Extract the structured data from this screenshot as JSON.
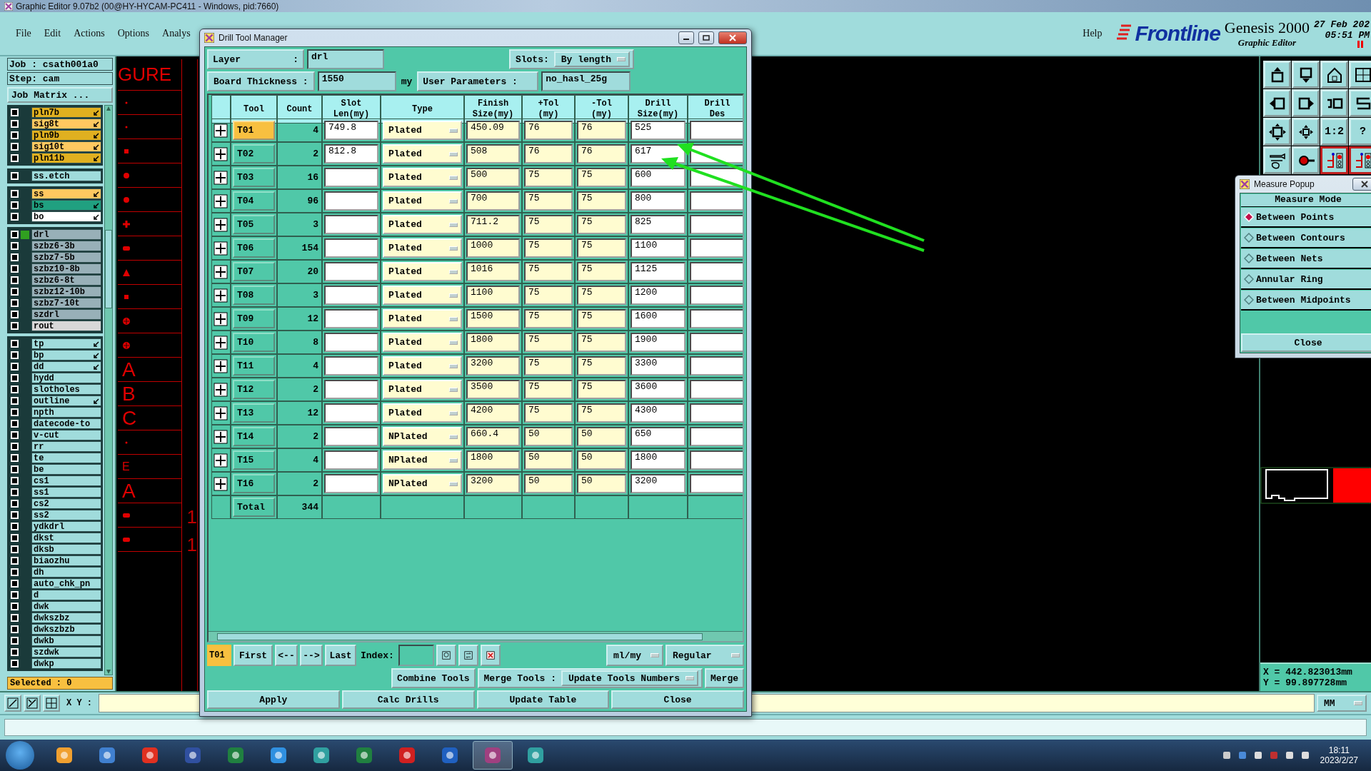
{
  "window": {
    "title": "Graphic Editor 9.07b2 (00@HY-HYCAM-PC411 - Windows, pid:7660)"
  },
  "menu": [
    "File",
    "Edit",
    "Actions",
    "Options",
    "Analys"
  ],
  "help": "Help",
  "brand": {
    "logo": "Frontline",
    "product": "Genesis 2000",
    "subtitle": "Graphic Editor",
    "date": "27 Feb 202",
    "time": "05:51 PM"
  },
  "job": {
    "job": "Job : csath001a0",
    "step": "Step: cam",
    "matrix_button": "Job Matrix ..."
  },
  "layer_groups": [
    {
      "layers": [
        {
          "name": "pln7b",
          "color": "#e0b020",
          "arrow": true,
          "checked": false,
          "selected": false
        },
        {
          "name": "sig8t",
          "color": "#ffc860",
          "arrow": true,
          "checked": false,
          "selected": false
        },
        {
          "name": "pln9b",
          "color": "#e0b020",
          "arrow": true,
          "checked": false,
          "selected": false
        },
        {
          "name": "sig10t",
          "color": "#ffc860",
          "arrow": true,
          "checked": false,
          "selected": false
        },
        {
          "name": "pln11b",
          "color": "#e0b020",
          "arrow": true,
          "checked": false,
          "selected": false
        }
      ]
    },
    {
      "layers": [
        {
          "name": "ss.etch",
          "color": "#a0dcdc",
          "arrow": false,
          "checked": false,
          "selected": false
        }
      ]
    },
    {
      "layers": [
        {
          "name": "ss",
          "color": "#ffc860",
          "arrow": true,
          "checked": false,
          "selected": false
        },
        {
          "name": "bs",
          "color": "#20a080",
          "arrow": true,
          "checked": false,
          "selected": false
        },
        {
          "name": "bo",
          "color": "#ffffff",
          "arrow": true,
          "checked": false,
          "selected": false
        }
      ]
    },
    {
      "layers": [
        {
          "name": "drl",
          "color": "#98b0b8",
          "arrow": false,
          "checked": false,
          "selected": true
        },
        {
          "name": "szbz6-3b",
          "color": "#98b0b8",
          "arrow": false,
          "checked": false,
          "selected": false
        },
        {
          "name": "szbz7-5b",
          "color": "#98b0b8",
          "arrow": false,
          "checked": false,
          "selected": false
        },
        {
          "name": "szbz10-8b",
          "color": "#98b0b8",
          "arrow": false,
          "checked": false,
          "selected": false
        },
        {
          "name": "szbz6-8t",
          "color": "#98b0b8",
          "arrow": false,
          "checked": false,
          "selected": false
        },
        {
          "name": "szbz12-10b",
          "color": "#98b0b8",
          "arrow": false,
          "checked": false,
          "selected": false
        },
        {
          "name": "szbz7-10t",
          "color": "#98b0b8",
          "arrow": false,
          "checked": false,
          "selected": false
        },
        {
          "name": "szdrl",
          "color": "#98b0b8",
          "arrow": false,
          "checked": false,
          "selected": false
        },
        {
          "name": "rout",
          "color": "#d8d8d8",
          "arrow": false,
          "checked": false,
          "selected": false
        }
      ]
    },
    {
      "layers": [
        {
          "name": "tp",
          "color": "#a0dcdc",
          "arrow": true,
          "checked": false,
          "selected": false
        },
        {
          "name": "bp",
          "color": "#a0dcdc",
          "arrow": true,
          "checked": false,
          "selected": false
        },
        {
          "name": "dd",
          "color": "#a0dcdc",
          "arrow": true,
          "checked": false,
          "selected": false
        },
        {
          "name": "hydd",
          "color": "#a0dcdc",
          "arrow": false,
          "checked": false,
          "selected": false
        },
        {
          "name": "slotholes",
          "color": "#a0dcdc",
          "arrow": false,
          "checked": false,
          "selected": false
        },
        {
          "name": "outline",
          "color": "#a0dcdc",
          "arrow": true,
          "checked": false,
          "selected": false
        },
        {
          "name": "npth",
          "color": "#a0dcdc",
          "arrow": false,
          "checked": false,
          "selected": false
        },
        {
          "name": "datecode-to",
          "color": "#a0dcdc",
          "arrow": false,
          "checked": false,
          "selected": false
        },
        {
          "name": "v-cut",
          "color": "#a0dcdc",
          "arrow": false,
          "checked": false,
          "selected": false
        },
        {
          "name": "rr",
          "color": "#a0dcdc",
          "arrow": false,
          "checked": false,
          "selected": false
        },
        {
          "name": "te",
          "color": "#a0dcdc",
          "arrow": false,
          "checked": false,
          "selected": false
        },
        {
          "name": "be",
          "color": "#a0dcdc",
          "arrow": false,
          "checked": false,
          "selected": false
        },
        {
          "name": "cs1",
          "color": "#a0dcdc",
          "arrow": false,
          "checked": false,
          "selected": false
        },
        {
          "name": "ss1",
          "color": "#a0dcdc",
          "arrow": false,
          "checked": false,
          "selected": false
        },
        {
          "name": "cs2",
          "color": "#a0dcdc",
          "arrow": false,
          "checked": false,
          "selected": false
        },
        {
          "name": "ss2",
          "color": "#a0dcdc",
          "arrow": false,
          "checked": false,
          "selected": false
        },
        {
          "name": "ydkdrl",
          "color": "#a0dcdc",
          "arrow": false,
          "checked": false,
          "selected": false
        },
        {
          "name": "dkst",
          "color": "#a0dcdc",
          "arrow": false,
          "checked": false,
          "selected": false
        },
        {
          "name": "dksb",
          "color": "#a0dcdc",
          "arrow": false,
          "checked": false,
          "selected": false
        },
        {
          "name": "biaozhu",
          "color": "#a0dcdc",
          "arrow": false,
          "checked": false,
          "selected": false
        },
        {
          "name": "dh",
          "color": "#a0dcdc",
          "arrow": false,
          "checked": false,
          "selected": false
        },
        {
          "name": "auto_chk_pn",
          "color": "#a0dcdc",
          "arrow": false,
          "checked": false,
          "selected": false
        },
        {
          "name": "d",
          "color": "#a0dcdc",
          "arrow": false,
          "checked": false,
          "selected": false
        },
        {
          "name": "dwk",
          "color": "#a0dcdc",
          "arrow": false,
          "checked": false,
          "selected": false
        },
        {
          "name": "dwkszbz",
          "color": "#a0dcdc",
          "arrow": false,
          "checked": false,
          "selected": false
        },
        {
          "name": "dwkszbzb",
          "color": "#a0dcdc",
          "arrow": false,
          "checked": false,
          "selected": false
        },
        {
          "name": "dwkb",
          "color": "#a0dcdc",
          "arrow": false,
          "checked": false,
          "selected": false
        },
        {
          "name": "szdwk",
          "color": "#a0dcdc",
          "arrow": false,
          "checked": false,
          "selected": false
        },
        {
          "name": "dwkp",
          "color": "#a0dcdc",
          "arrow": false,
          "checked": false,
          "selected": false
        }
      ]
    }
  ],
  "selected_count": "Selected : 0",
  "canvas": {
    "header": "GURE",
    "legend": [
      {
        "kind": "dot"
      },
      {
        "kind": "dot"
      },
      {
        "kind": "square"
      },
      {
        "kind": "circle"
      },
      {
        "kind": "circle"
      },
      {
        "kind": "plus"
      },
      {
        "kind": "bar"
      },
      {
        "kind": "triangle"
      },
      {
        "kind": "square"
      },
      {
        "kind": "target"
      },
      {
        "kind": "target"
      },
      {
        "kind": "letter",
        "text": "A"
      },
      {
        "kind": "letter",
        "text": "B"
      },
      {
        "kind": "letter",
        "text": "C"
      },
      {
        "kind": "dot"
      },
      {
        "kind": "small_letter",
        "text": "E"
      },
      {
        "kind": "letter",
        "text": "A"
      },
      {
        "kind": "bar"
      },
      {
        "kind": "bar"
      }
    ],
    "side_labels": [
      "1",
      "1"
    ]
  },
  "toolbar": [
    {
      "kind": "box_up",
      "active": false
    },
    {
      "kind": "box_down",
      "active": false
    },
    {
      "kind": "house",
      "active": false
    },
    {
      "kind": "grid",
      "active": false
    },
    {
      "kind": "box_left",
      "active": false
    },
    {
      "kind": "box_right",
      "active": false
    },
    {
      "kind": "undo",
      "active": false
    },
    {
      "kind": "s_path",
      "active": false
    },
    {
      "kind": "fit",
      "active": false
    },
    {
      "kind": "pan",
      "active": false
    },
    {
      "kind": "text",
      "text": "1:2",
      "active": false
    },
    {
      "kind": "text",
      "text": "?",
      "active": false
    },
    {
      "kind": "wrench",
      "active": false
    },
    {
      "kind": "pin",
      "active": false
    },
    {
      "kind": "circuit",
      "active": true
    },
    {
      "kind": "circuit",
      "active": true
    }
  ],
  "coords": {
    "x": "X = 442.823013mm",
    "y": "Y = 99.897728mm"
  },
  "xy_bar": {
    "label": "X Y :",
    "units": "MM"
  },
  "taskbar": {
    "time": "18:11",
    "date": "2023/2/27"
  },
  "drill_manager": {
    "title": "Drill Tool Manager",
    "layer_label": "Layer",
    "layer_sep": ":",
    "layer": "drl",
    "slots_label": "Slots:",
    "slots": "By length",
    "thickness_label": "Board Thickness :",
    "thickness": "1550",
    "thickness_unit": "my",
    "user_params_label": "User Parameters :",
    "user_params": "no_hasl_25g",
    "columns": [
      "Tool",
      "Count",
      "Slot\nLen(my)",
      "Type",
      "Finish\nSize(my)",
      "+Tol\n(my)",
      "-Tol\n(my)",
      "Drill\nSize(my)",
      "Drill\nDes"
    ],
    "rows": [
      {
        "tool": "T01",
        "count": "4",
        "slot_len": "749.8",
        "type": "Plated",
        "finish": "450.09",
        "plus_tol": "76",
        "minus_tol": "76",
        "drill_size": "525",
        "selected": true
      },
      {
        "tool": "T02",
        "count": "2",
        "slot_len": "812.8",
        "type": "Plated",
        "finish": "508",
        "plus_tol": "76",
        "minus_tol": "76",
        "drill_size": "617",
        "selected": false
      },
      {
        "tool": "T03",
        "count": "16",
        "type": "Plated",
        "finish": "500",
        "plus_tol": "75",
        "minus_tol": "75",
        "drill_size": "600",
        "selected": false
      },
      {
        "tool": "T04",
        "count": "96",
        "type": "Plated",
        "finish": "700",
        "plus_tol": "75",
        "minus_tol": "75",
        "drill_size": "800",
        "selected": false
      },
      {
        "tool": "T05",
        "count": "3",
        "type": "Plated",
        "finish": "711.2",
        "plus_tol": "75",
        "minus_tol": "75",
        "drill_size": "825",
        "selected": false
      },
      {
        "tool": "T06",
        "count": "154",
        "type": "Plated",
        "finish": "1000",
        "plus_tol": "75",
        "minus_tol": "75",
        "drill_size": "1100",
        "selected": false
      },
      {
        "tool": "T07",
        "count": "20",
        "type": "Plated",
        "finish": "1016",
        "plus_tol": "75",
        "minus_tol": "75",
        "drill_size": "1125",
        "selected": false
      },
      {
        "tool": "T08",
        "count": "3",
        "type": "Plated",
        "finish": "1100",
        "plus_tol": "75",
        "minus_tol": "75",
        "drill_size": "1200",
        "selected": false
      },
      {
        "tool": "T09",
        "count": "12",
        "type": "Plated",
        "finish": "1500",
        "plus_tol": "75",
        "minus_tol": "75",
        "drill_size": "1600",
        "selected": false
      },
      {
        "tool": "T10",
        "count": "8",
        "type": "Plated",
        "finish": "1800",
        "plus_tol": "75",
        "minus_tol": "75",
        "drill_size": "1900",
        "selected": false
      },
      {
        "tool": "T11",
        "count": "4",
        "type": "Plated",
        "finish": "3200",
        "plus_tol": "75",
        "minus_tol": "75",
        "drill_size": "3300",
        "selected": false
      },
      {
        "tool": "T12",
        "count": "2",
        "type": "Plated",
        "finish": "3500",
        "plus_tol": "75",
        "minus_tol": "75",
        "drill_size": "3600",
        "selected": false
      },
      {
        "tool": "T13",
        "count": "12",
        "type": "Plated",
        "finish": "4200",
        "plus_tol": "75",
        "minus_tol": "75",
        "drill_size": "4300",
        "selected": false
      },
      {
        "tool": "T14",
        "count": "2",
        "type": "NPlated",
        "finish": "660.4",
        "plus_tol": "50",
        "minus_tol": "50",
        "drill_size": "650",
        "selected": false
      },
      {
        "tool": "T15",
        "count": "4",
        "type": "NPlated",
        "finish": "1800",
        "plus_tol": "50",
        "minus_tol": "50",
        "drill_size": "1800",
        "selected": false
      },
      {
        "tool": "T16",
        "count": "2",
        "type": "NPlated",
        "finish": "3200",
        "plus_tol": "50",
        "minus_tol": "50",
        "drill_size": "3200",
        "selected": false
      }
    ],
    "total_label": "Total",
    "total": "344",
    "nav": {
      "current": "T01",
      "first": "First",
      "prev": "<--",
      "next": "-->",
      "last": "Last",
      "index_label": "Index:",
      "units": "ml/my",
      "mode": "Regular"
    },
    "actions": {
      "combine": "Combine Tools",
      "merge_label": "Merge Tools :",
      "update_numbers": "Update Tools Numbers",
      "merge": "Merge"
    },
    "buttons": [
      "Apply",
      "Calc Drills",
      "Update Table",
      "Close"
    ]
  },
  "measure_popup": {
    "title": "Measure Popup",
    "heading": "Measure Mode",
    "modes": [
      {
        "label": "Between Points",
        "selected": true
      },
      {
        "label": "Between Contours",
        "selected": false
      },
      {
        "label": "Between Nets",
        "selected": false
      },
      {
        "label": "Annular Ring",
        "selected": false
      },
      {
        "label": "Between Midpoints",
        "selected": false
      }
    ],
    "close": "Close"
  }
}
